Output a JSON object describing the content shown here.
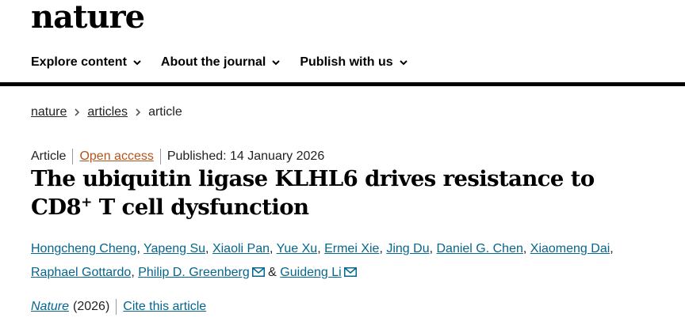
{
  "site": {
    "logo": "nature"
  },
  "nav": [
    {
      "label": "Explore content"
    },
    {
      "label": "About the journal"
    },
    {
      "label": "Publish with us"
    }
  ],
  "breadcrumb": [
    {
      "label": "nature"
    },
    {
      "label": "articles"
    },
    {
      "label": "article"
    }
  ],
  "article": {
    "type": "Article",
    "access": "Open access",
    "published": "Published: 14 January 2026",
    "title_part1": "The ubiquitin ligase KLHL6 drives resistance to CD8",
    "title_sup": "+",
    "title_part2": " T cell dysfunction",
    "authors": [
      "Hongcheng Cheng",
      "Yapeng Su",
      "Xiaoli Pan",
      "Yue Xu",
      "Ermei Xie",
      "Jing Du",
      "Daniel G. Chen",
      "Xiaomeng Dai",
      "Raphael Gottardo",
      "Philip D. Greenberg",
      "Guideng Li"
    ],
    "journal": "Nature",
    "year": "(2026)",
    "cite_label": "Cite this article"
  },
  "colors": {
    "link": "#05668d",
    "open_access": "#b3541e",
    "rule": "#000000"
  },
  "icons": {
    "nav_chevron": "chevron-down-icon",
    "breadcrumb_sep": "chevron-right-icon",
    "email": "mail-icon"
  }
}
